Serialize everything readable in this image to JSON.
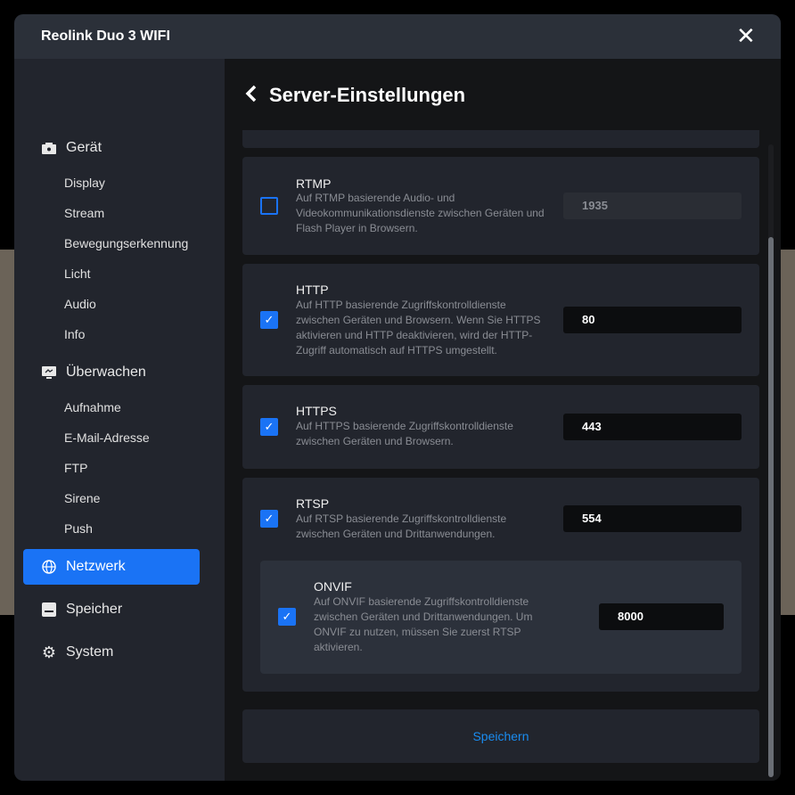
{
  "window": {
    "title": "Reolink Duo 3 WIFI"
  },
  "sidebar": {
    "groups": [
      {
        "label": "Gerät",
        "icon": "camera-icon",
        "items": [
          "Display",
          "Stream",
          "Bewegungserkennung",
          "Licht",
          "Audio",
          "Info"
        ]
      },
      {
        "label": "Überwachen",
        "icon": "monitor-icon",
        "items": [
          "Aufnahme",
          "E-Mail-Adresse",
          "FTP",
          "Sirene",
          "Push"
        ]
      },
      {
        "label": "Netzwerk",
        "icon": "globe-icon",
        "active": true
      },
      {
        "label": "Speicher",
        "icon": "storage-icon"
      },
      {
        "label": "System",
        "icon": "gear-icon"
      }
    ]
  },
  "page": {
    "title": "Server-Einstellungen"
  },
  "services": [
    {
      "name": "RTMP",
      "enabled": false,
      "desc": "Auf RTMP basierende Audio- und Videokommunikationsdienste zwischen Geräten und Flash Player in Browsern.",
      "port": "1935"
    },
    {
      "name": "HTTP",
      "enabled": true,
      "desc": "Auf HTTP basierende Zugriffskontrolldienste zwischen Geräten und Browsern. Wenn Sie HTTPS aktivieren und HTTP deaktivieren, wird der HTTP-Zugriff automatisch auf HTTPS umgestellt.",
      "port": "80"
    },
    {
      "name": "HTTPS",
      "enabled": true,
      "desc": "Auf HTTPS basierende Zugriffskontrolldienste zwischen Geräten und Browsern.",
      "port": "443"
    },
    {
      "name": "RTSP",
      "enabled": true,
      "desc": "Auf RTSP basierende Zugriffskontrolldienste zwischen Geräten und Drittanwendungen.",
      "port": "554"
    },
    {
      "name": "ONVIF",
      "enabled": true,
      "desc": "Auf ONVIF basierende Zugriffskontrolldienste zwischen Geräten und Drittanwendungen. Um ONVIF zu nutzen, müssen Sie zuerst RTSP aktivieren.",
      "port": "8000"
    }
  ],
  "save_label": "Speichern",
  "check_glyph": "✓"
}
